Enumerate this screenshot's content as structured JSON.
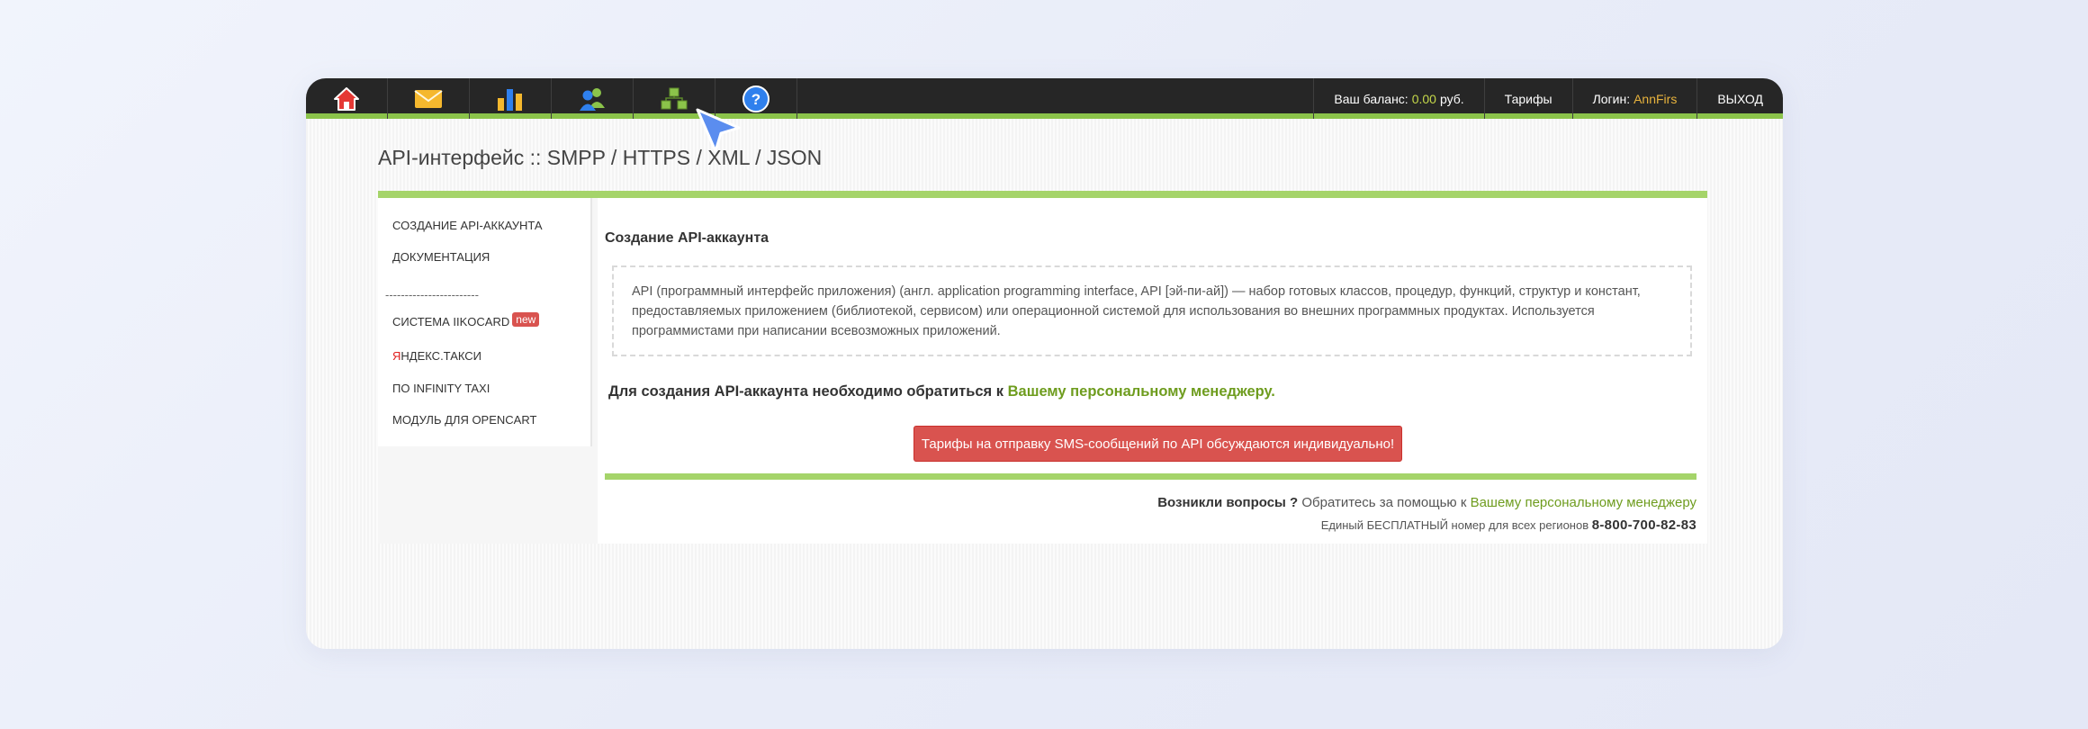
{
  "topbar": {
    "nav_icons": [
      "home-icon",
      "mail-icon",
      "bar-chart-icon",
      "users-icon",
      "hierarchy-icon",
      "help-icon"
    ],
    "balance_label": "Ваш баланс:",
    "balance_value": "0.00",
    "balance_currency": "руб.",
    "tariffs_label": "Тарифы",
    "login_label": "Логин:",
    "login_value": "AnnFirs",
    "logout_label": "ВЫХОД",
    "colors": {
      "bar_bg": "#262626",
      "accent_green": "#8bc34a",
      "balance_yellow": "#c5d84a",
      "login_orange": "#e8b33d"
    }
  },
  "page": {
    "title": "API-интерфейс :: SMPP / HTTPS / XML / JSON"
  },
  "sidebar": {
    "items": [
      {
        "label": "Создание API-аккаунта"
      },
      {
        "label": "Документация"
      },
      {
        "label": "Система IIKOCARD",
        "badge": "new"
      },
      {
        "label_first": "Я",
        "label_rest": "ндекс.Такси"
      },
      {
        "label": "по INFINITY TAXI"
      },
      {
        "label": "Модуль для OPENCART"
      }
    ],
    "separator": "------------------------"
  },
  "main": {
    "heading": "Создание API-аккаунта",
    "definition": "API (программный интерфейс приложения) (англ. application programming interface, API [эй-пи-ай]) — набор готовых классов, процедур, функций, структур и констант, предоставляемых приложением (библиотекой, сервисом) или операционной системой для использования во внешних программных продуктах. Используется программистами при написании всевозможных приложений.",
    "instruction_text": "Для создания API-аккаунта необходимо обратиться к",
    "instruction_link": "Вашему персональному менеджеру",
    "instruction_end": ".",
    "cta_label": "Тарифы на отправку SMS-сообщений по API обсуждаются индивидуально!",
    "questions_bold": "Возникли вопросы ?",
    "questions_text": "Обратитесь за помощью к",
    "questions_link": "Вашему персональному менеджеру",
    "phone_label": "Единый БЕСПЛАТНЫЙ номер для всех регионов",
    "phone_number": "8-800-700-82-83",
    "colors": {
      "cta_red": "#d9534f",
      "link_green": "#6e9c1e",
      "divider_green": "#a5d46a"
    }
  }
}
